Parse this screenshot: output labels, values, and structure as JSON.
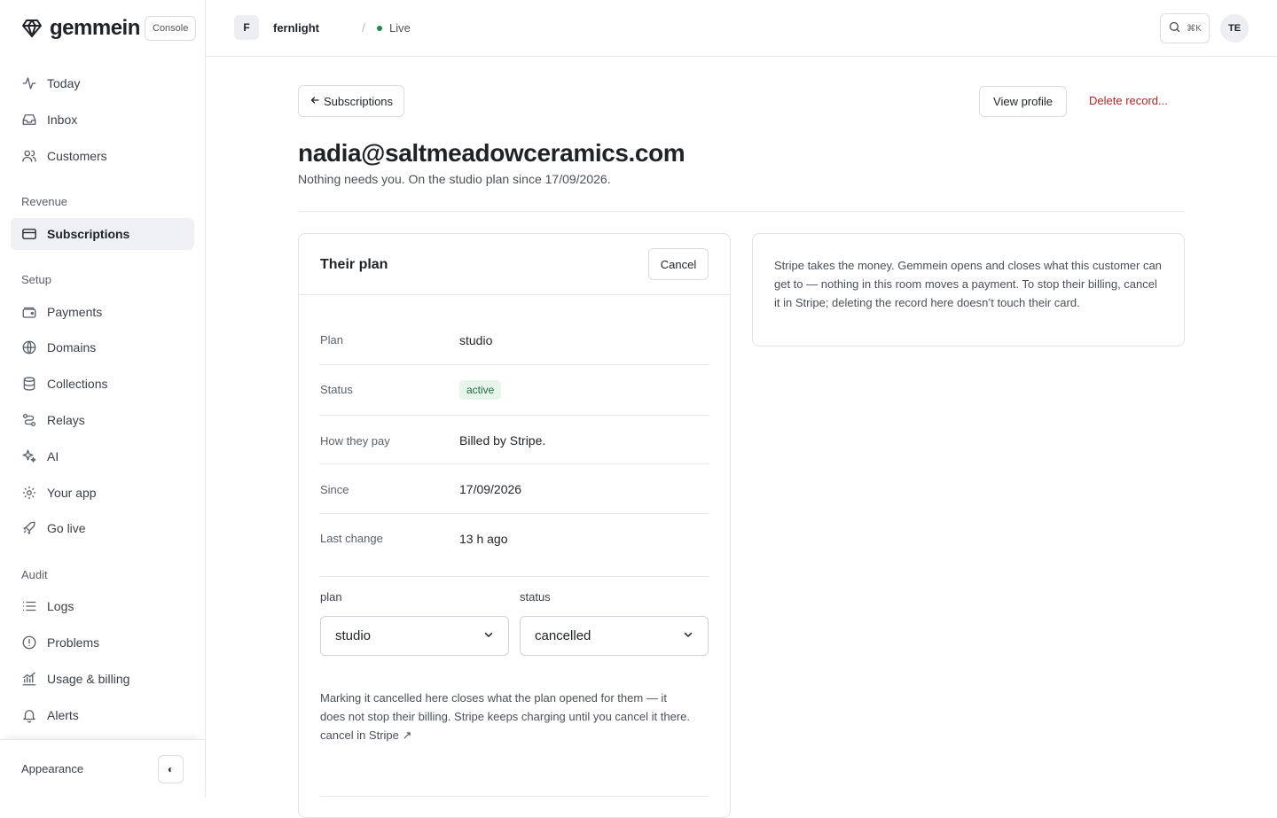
{
  "brand": {
    "name": "gemmein",
    "console_label": "Console"
  },
  "nav": {
    "top": [
      {
        "label": "Today",
        "icon": "activity-icon"
      },
      {
        "label": "Inbox",
        "icon": "inbox-icon"
      },
      {
        "label": "Customers",
        "icon": "users-icon"
      }
    ],
    "revenue_label": "Revenue",
    "revenue": [
      {
        "label": "Subscriptions",
        "icon": "credit-card-icon",
        "active": true
      }
    ],
    "setup_label": "Setup",
    "setup": [
      {
        "label": "Payments",
        "icon": "wallet-icon"
      },
      {
        "label": "Domains",
        "icon": "globe-icon"
      },
      {
        "label": "Collections",
        "icon": "database-icon"
      },
      {
        "label": "Relays",
        "icon": "route-icon"
      },
      {
        "label": "AI",
        "icon": "sparkles-icon"
      },
      {
        "label": "Your app",
        "icon": "gear-icon"
      },
      {
        "label": "Go live",
        "icon": "rocket-icon"
      }
    ],
    "audit_label": "Audit",
    "audit": [
      {
        "label": "Logs",
        "icon": "list-icon"
      },
      {
        "label": "Problems",
        "icon": "alert-circle-icon"
      },
      {
        "label": "Usage & billing",
        "icon": "chart-icon"
      },
      {
        "label": "Alerts",
        "icon": "bell-icon"
      }
    ],
    "appearance_label": "Appearance",
    "theme_toggle": "◐"
  },
  "topbar": {
    "workspace_initial": "F",
    "workspace_name": "fernlight",
    "separator": "/",
    "env_label": "Live",
    "env_color": "#1f8a4c",
    "search_kbd": "⌘K",
    "user_initials": "TE"
  },
  "page": {
    "back_label": "Subscriptions",
    "view_profile_label": "View profile",
    "delete_label": "Delete record...",
    "title": "nadia@saltmeadowceramics.com",
    "subtitle": "Nothing needs you. On the studio plan since 17/09/2026."
  },
  "plan_card": {
    "title": "Their plan",
    "cancel_label": "Cancel",
    "rows": [
      {
        "key": "Plan",
        "value": "studio"
      },
      {
        "key": "Status",
        "value": "active"
      },
      {
        "key": "How they pay",
        "value": "Billed by Stripe."
      },
      {
        "key": "Since",
        "value": "17/09/2026"
      },
      {
        "key": "Last change",
        "value": "13 h ago"
      }
    ],
    "plan_field_label": "plan",
    "plan_value": "studio",
    "status_field_label": "status",
    "status_value": "cancelled",
    "note": "Marking it cancelled here closes what the plan opened for them — it does not stop their billing. Stripe keeps charging until you cancel it there.",
    "note_link": "cancel in Stripe ↗"
  },
  "info_card": {
    "text": "Stripe takes the money. Gemmein opens and closes what this customer can get to — nothing in this room moves a payment. To stop their billing, cancel it in Stripe; deleting the record here doesn’t touch their card."
  },
  "colors": {
    "accent_danger": "#b4232c",
    "badge_bg": "#e6f4ea",
    "badge_text": "#1e6b3d"
  }
}
